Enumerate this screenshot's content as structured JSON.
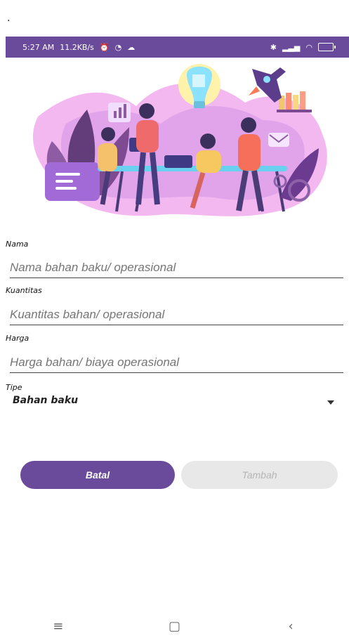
{
  "top_dot": ".",
  "status_bar": {
    "time": "5:27 AM",
    "speed": "11.2KB/s",
    "battery": "36"
  },
  "form": {
    "name": {
      "label": "Nama",
      "placeholder": "Nama bahan baku/ operasional"
    },
    "quantity": {
      "label": "Kuantitas",
      "placeholder": "Kuantitas bahan/ operasional"
    },
    "price": {
      "label": "Harga",
      "placeholder": "Harga bahan/ biaya operasional"
    },
    "type": {
      "label": "Tipe",
      "value": "Bahan baku"
    }
  },
  "buttons": {
    "cancel": "Batal",
    "add": "Tambah"
  },
  "icons": {
    "menu": "menu-icon",
    "home": "home-icon",
    "back": "back-icon"
  }
}
